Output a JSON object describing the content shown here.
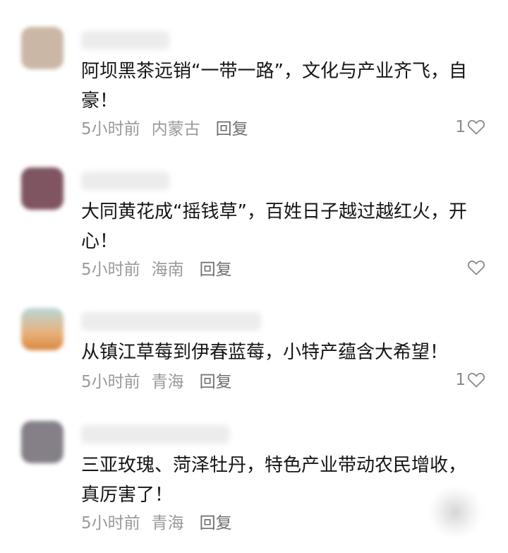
{
  "comments": [
    {
      "text": "阿坝黑茶远销“一带一路”，文化与产业齐飞，自豪！",
      "time": "5小时前",
      "location": "内蒙古",
      "reply_label": "回复",
      "like_count": "1",
      "avatar_color": "#cbb7a6"
    },
    {
      "text": "大同黄花成“摇钱草”，百姓日子越过越红火，开心！",
      "time": "5小时前",
      "location": "海南",
      "reply_label": "回复",
      "like_count": "",
      "avatar_color": "#7e5560"
    },
    {
      "text": "从镇江草莓到伊春蓝莓，小特产蕴含大希望！",
      "time": "5小时前",
      "location": "青海",
      "reply_label": "回复",
      "like_count": "1",
      "avatar_color": "#e2a56a"
    },
    {
      "text": "三亚玫瑰、菏泽牡丹，特色产业带动农民增收，真厉害了！",
      "time": "5小时前",
      "location": "青海",
      "reply_label": "回复",
      "like_count": "",
      "avatar_color": "#858088"
    }
  ]
}
